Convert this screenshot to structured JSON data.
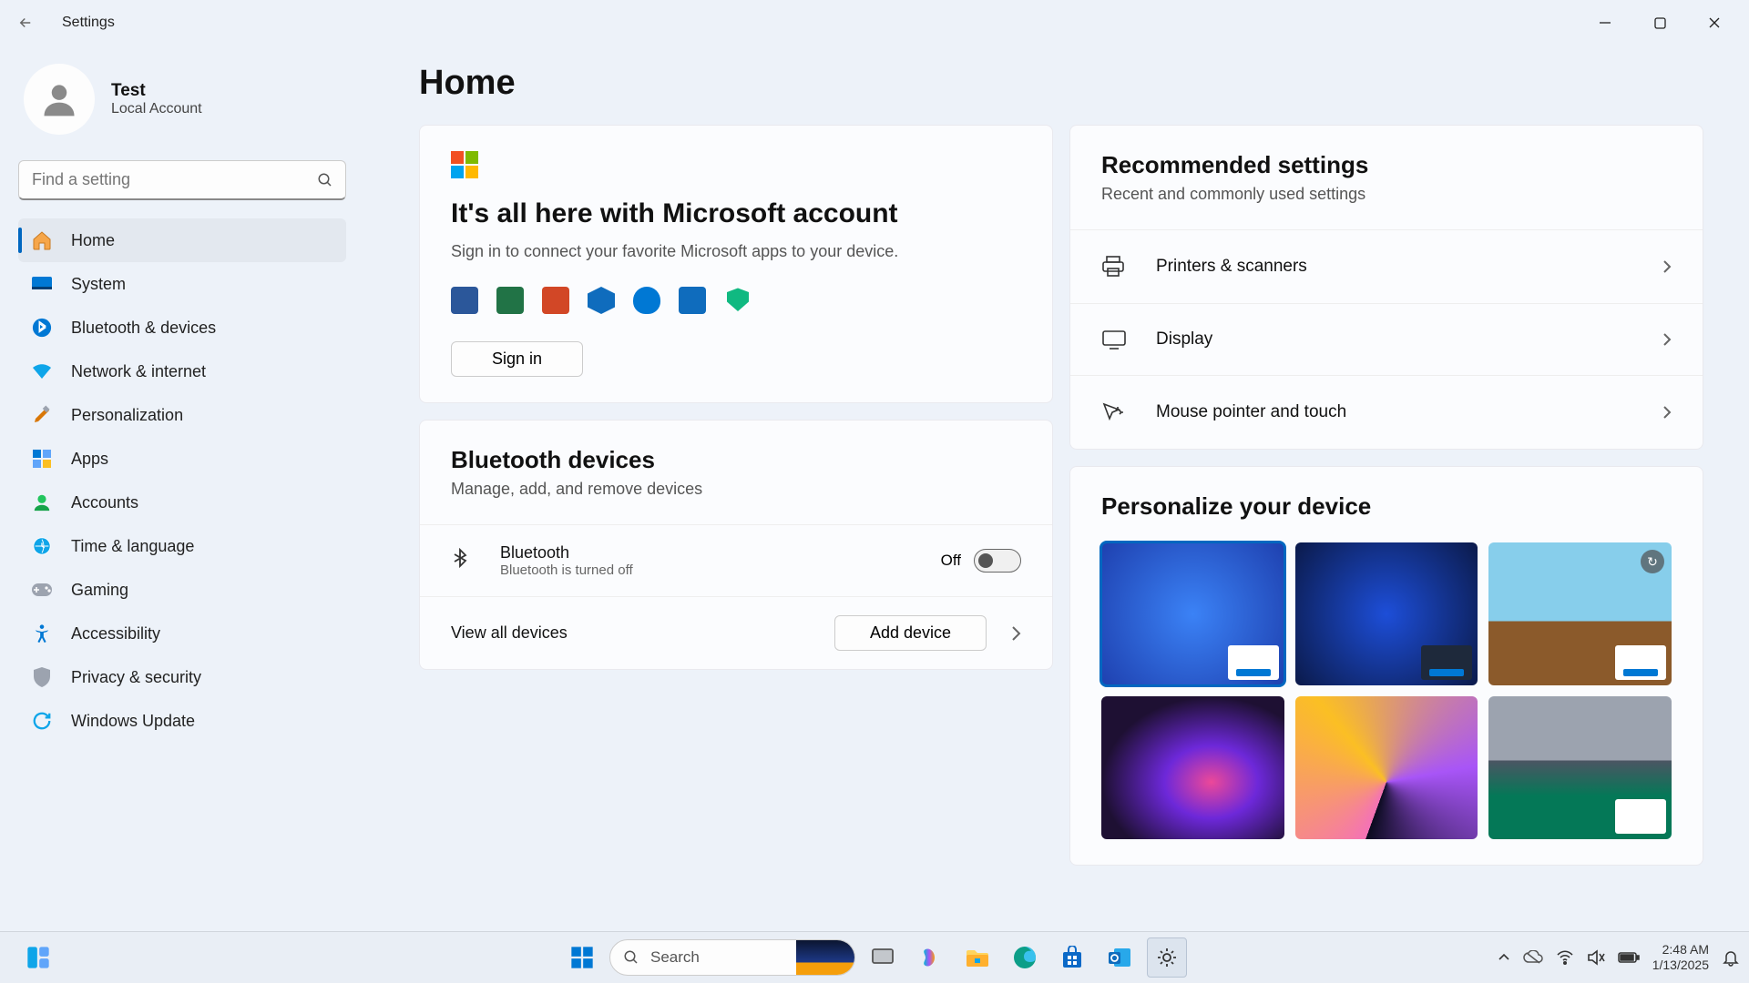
{
  "window": {
    "title": "Settings"
  },
  "profile": {
    "name": "Test",
    "sub": "Local Account"
  },
  "search": {
    "placeholder": "Find a setting"
  },
  "nav": [
    {
      "label": "Home",
      "icon": "home",
      "selected": true
    },
    {
      "label": "System",
      "icon": "system"
    },
    {
      "label": "Bluetooth & devices",
      "icon": "bluetooth"
    },
    {
      "label": "Network & internet",
      "icon": "wifi"
    },
    {
      "label": "Personalization",
      "icon": "brush"
    },
    {
      "label": "Apps",
      "icon": "apps"
    },
    {
      "label": "Accounts",
      "icon": "account"
    },
    {
      "label": "Time & language",
      "icon": "time"
    },
    {
      "label": "Gaming",
      "icon": "gaming"
    },
    {
      "label": "Accessibility",
      "icon": "accessibility"
    },
    {
      "label": "Privacy & security",
      "icon": "privacy"
    },
    {
      "label": "Windows Update",
      "icon": "update"
    }
  ],
  "page": {
    "title": "Home"
  },
  "msCard": {
    "title": "It's all here with Microsoft account",
    "sub": "Sign in to connect your favorite Microsoft apps to your device.",
    "signin": "Sign in"
  },
  "btCard": {
    "title": "Bluetooth devices",
    "sub": "Manage, add, and remove devices",
    "row_label": "Bluetooth",
    "row_sub": "Bluetooth is turned off",
    "toggle_state": "Off",
    "view_all": "View all devices",
    "add": "Add device"
  },
  "recCard": {
    "title": "Recommended settings",
    "sub": "Recent and commonly used settings",
    "rows": [
      "Printers & scanners",
      "Display",
      "Mouse pointer and touch"
    ]
  },
  "persCard": {
    "title": "Personalize your device"
  },
  "taskbar": {
    "search": "Search",
    "time": "2:48 AM",
    "date": "1/13/2025"
  }
}
